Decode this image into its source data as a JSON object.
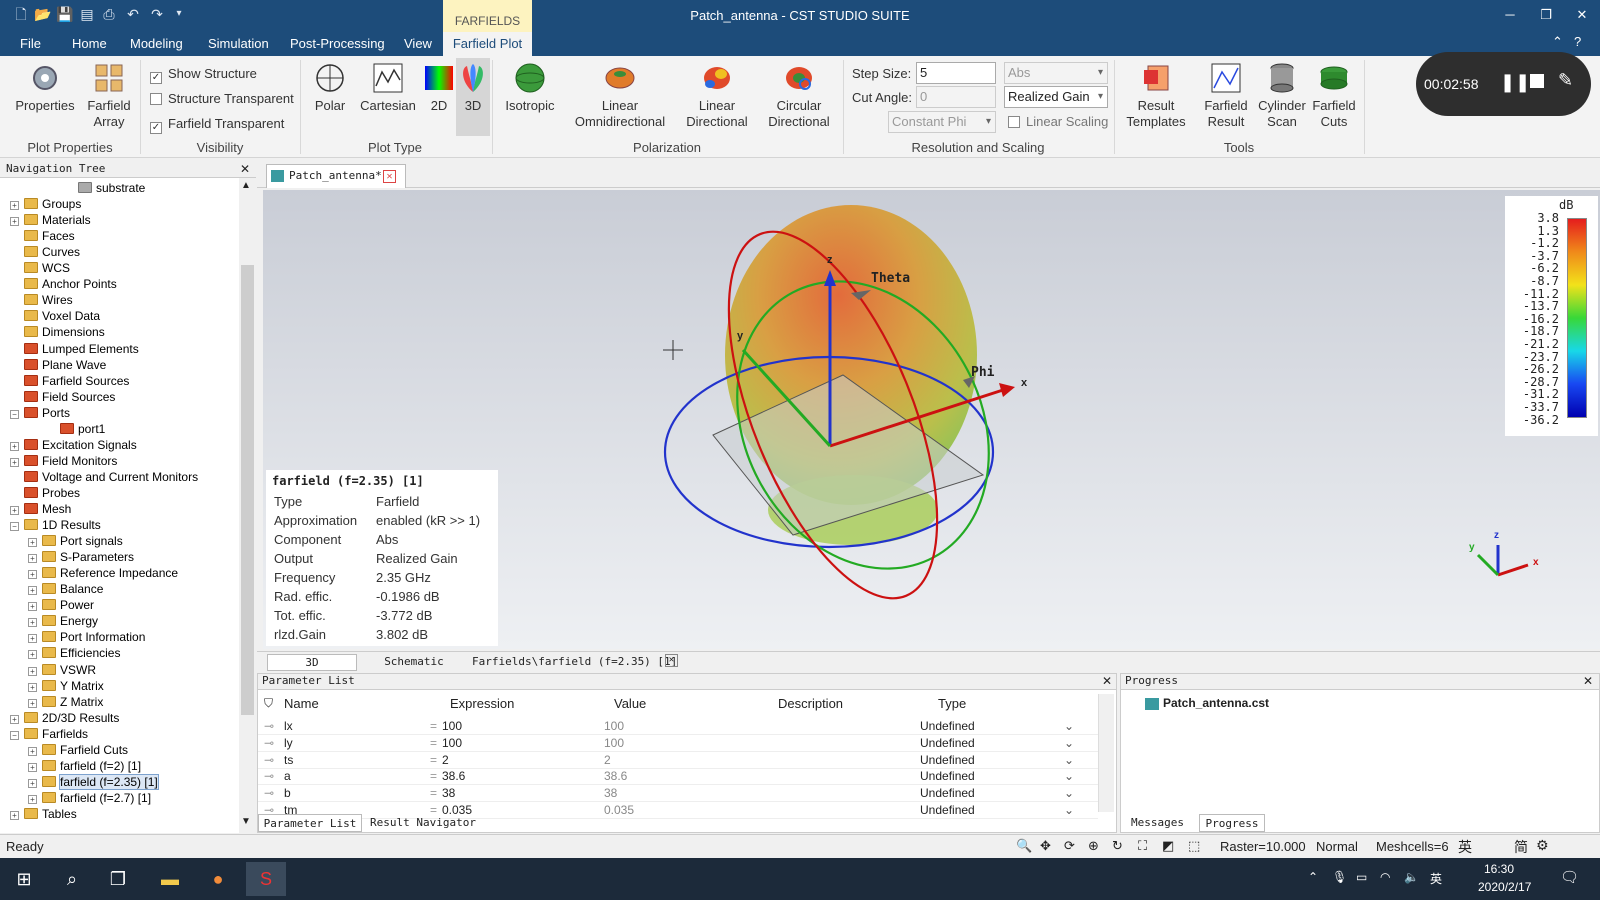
{
  "app": {
    "title": "Patch_antenna - CST STUDIO SUITE",
    "context_tab_group": "FARFIELDS"
  },
  "menu": [
    "File",
    "Home",
    "Modeling",
    "Simulation",
    "Post-Processing",
    "View",
    "Farfield Plot"
  ],
  "ribbon": {
    "plot_properties": {
      "properties": "Properties",
      "farfield_array_1": "Farfield",
      "farfield_array_2": "Array",
      "label": "Plot Properties"
    },
    "visibility": {
      "show_structure": "Show Structure",
      "structure_transparent": "Structure Transparent",
      "farfield_transparent": "Farfield Transparent",
      "label": "Visibility"
    },
    "plot_type": {
      "polar": "Polar",
      "cartesian": "Cartesian",
      "twod": "2D",
      "threed": "3D",
      "label": "Plot Type"
    },
    "polarization": {
      "isotropic": "Isotropic",
      "linear_omni_1": "Linear",
      "linear_omni_2": "Omnidirectional",
      "linear_dir_1": "Linear",
      "linear_dir_2": "Directional",
      "circular_dir_1": "Circular",
      "circular_dir_2": "Directional",
      "label": "Polarization"
    },
    "resolution": {
      "step_size_label": "Step Size:",
      "step_size_value": "5",
      "cut_angle_label": "Cut Angle:",
      "cut_angle_value": "0",
      "constant_phi": "Constant Phi",
      "abs": "Abs",
      "realized_gain": "Realized Gain",
      "linear_scaling": "Linear Scaling",
      "label": "Resolution and Scaling"
    },
    "tools": {
      "result_templates_1": "Result",
      "result_templates_2": "Templates",
      "farfield_result_1": "Farfield",
      "farfield_result_2": "Result",
      "cylinder_scan_1": "Cylinder",
      "cylinder_scan_2": "Scan",
      "farfield_cuts_1": "Farfield",
      "farfield_cuts_2": "Cuts",
      "label": "Tools"
    }
  },
  "recorder": {
    "time": "00:02:58"
  },
  "nav": {
    "title": "Navigation Tree",
    "items": [
      {
        "label": "substrate",
        "indent": 3,
        "icon": "gray",
        "exp": ""
      },
      {
        "label": "Groups",
        "indent": 0,
        "icon": "fold",
        "exp": "+"
      },
      {
        "label": "Materials",
        "indent": 0,
        "icon": "fold",
        "exp": "+"
      },
      {
        "label": "Faces",
        "indent": 0,
        "icon": "fold",
        "exp": ""
      },
      {
        "label": "Curves",
        "indent": 0,
        "icon": "fold",
        "exp": ""
      },
      {
        "label": "WCS",
        "indent": 0,
        "icon": "fold",
        "exp": ""
      },
      {
        "label": "Anchor Points",
        "indent": 0,
        "icon": "fold",
        "exp": ""
      },
      {
        "label": "Wires",
        "indent": 0,
        "icon": "fold",
        "exp": ""
      },
      {
        "label": "Voxel Data",
        "indent": 0,
        "icon": "fold",
        "exp": ""
      },
      {
        "label": "Dimensions",
        "indent": 0,
        "icon": "fold",
        "exp": ""
      },
      {
        "label": "Lumped Elements",
        "indent": 0,
        "icon": "red",
        "exp": ""
      },
      {
        "label": "Plane Wave",
        "indent": 0,
        "icon": "red",
        "exp": ""
      },
      {
        "label": "Farfield Sources",
        "indent": 0,
        "icon": "red",
        "exp": ""
      },
      {
        "label": "Field Sources",
        "indent": 0,
        "icon": "red",
        "exp": ""
      },
      {
        "label": "Ports",
        "indent": 0,
        "icon": "red",
        "exp": "−"
      },
      {
        "label": "port1",
        "indent": 2,
        "icon": "red",
        "exp": ""
      },
      {
        "label": "Excitation Signals",
        "indent": 0,
        "icon": "red",
        "exp": "+"
      },
      {
        "label": "Field Monitors",
        "indent": 0,
        "icon": "red",
        "exp": "+"
      },
      {
        "label": "Voltage and Current Monitors",
        "indent": 0,
        "icon": "red",
        "exp": ""
      },
      {
        "label": "Probes",
        "indent": 0,
        "icon": "red",
        "exp": ""
      },
      {
        "label": "Mesh",
        "indent": 0,
        "icon": "red",
        "exp": "+"
      },
      {
        "label": "1D Results",
        "indent": 0,
        "icon": "fold",
        "exp": "−"
      },
      {
        "label": "Port signals",
        "indent": 1,
        "icon": "fold",
        "exp": "+"
      },
      {
        "label": "S-Parameters",
        "indent": 1,
        "icon": "fold",
        "exp": "+"
      },
      {
        "label": "Reference Impedance",
        "indent": 1,
        "icon": "fold",
        "exp": "+"
      },
      {
        "label": "Balance",
        "indent": 1,
        "icon": "fold",
        "exp": "+"
      },
      {
        "label": "Power",
        "indent": 1,
        "icon": "fold",
        "exp": "+"
      },
      {
        "label": "Energy",
        "indent": 1,
        "icon": "fold",
        "exp": "+"
      },
      {
        "label": "Port Information",
        "indent": 1,
        "icon": "fold",
        "exp": "+"
      },
      {
        "label": "Efficiencies",
        "indent": 1,
        "icon": "fold",
        "exp": "+"
      },
      {
        "label": "VSWR",
        "indent": 1,
        "icon": "fold",
        "exp": "+"
      },
      {
        "label": "Y Matrix",
        "indent": 1,
        "icon": "fold",
        "exp": "+"
      },
      {
        "label": "Z Matrix",
        "indent": 1,
        "icon": "fold",
        "exp": "+"
      },
      {
        "label": "2D/3D Results",
        "indent": 0,
        "icon": "fold",
        "exp": "+"
      },
      {
        "label": "Farfields",
        "indent": 0,
        "icon": "fold",
        "exp": "−"
      },
      {
        "label": "Farfield Cuts",
        "indent": 1,
        "icon": "fold",
        "exp": "+"
      },
      {
        "label": "farfield (f=2) [1]",
        "indent": 1,
        "icon": "fold",
        "exp": "+"
      },
      {
        "label": "farfield (f=2.35) [1]",
        "indent": 1,
        "icon": "fold",
        "exp": "+",
        "selected": true
      },
      {
        "label": "farfield (f=2.7) [1]",
        "indent": 1,
        "icon": "fold",
        "exp": "+"
      },
      {
        "label": "Tables",
        "indent": 0,
        "icon": "fold",
        "exp": "+"
      }
    ]
  },
  "doc_tab": "Patch_antenna*",
  "viewport": {
    "axis_theta": "Theta",
    "axis_phi": "Phi",
    "axis_x": "x",
    "axis_y": "y",
    "axis_z": "z",
    "legend": {
      "unit": "dB",
      "values": [
        "3.8",
        "1.3",
        "-1.2",
        "-3.7",
        "-6.2",
        "-8.7",
        "-11.2",
        "-13.7",
        "-16.2",
        "-18.7",
        "-21.2",
        "-23.7",
        "-26.2",
        "-28.7",
        "-31.2",
        "-33.7",
        "-36.2"
      ]
    },
    "info": {
      "title": "farfield (f=2.35) [1]",
      "rows": [
        {
          "k": "Type",
          "v": "Farfield"
        },
        {
          "k": "Approximation",
          "v": "enabled (kR >> 1)"
        },
        {
          "k": "Component",
          "v": "Abs"
        },
        {
          "k": "Output",
          "v": "Realized Gain"
        },
        {
          "k": "Frequency",
          "v": "2.35 GHz"
        },
        {
          "k": "Rad. effic.",
          "v": "-0.1986 dB"
        },
        {
          "k": "Tot. effic.",
          "v": "-3.772 dB"
        },
        {
          "k": "rlzd.Gain",
          "v": "3.802 dB"
        }
      ]
    },
    "mini_axes": {
      "x": "x",
      "y": "y",
      "z": "z"
    }
  },
  "view_tabs": [
    "3D",
    "Schematic",
    "Farfields\\farfield (f=2.35) [1]"
  ],
  "params": {
    "title": "Parameter List",
    "columns": [
      "Name",
      "Expression",
      "Value",
      "Description",
      "Type"
    ],
    "rows": [
      {
        "name": "lx",
        "expr": "100",
        "value": "100",
        "type": "Undefined"
      },
      {
        "name": "ly",
        "expr": "100",
        "value": "100",
        "type": "Undefined"
      },
      {
        "name": "ts",
        "expr": "2",
        "value": "2",
        "type": "Undefined"
      },
      {
        "name": "a",
        "expr": "38.6",
        "value": "38.6",
        "type": "Undefined"
      },
      {
        "name": "b",
        "expr": "38",
        "value": "38",
        "type": "Undefined"
      },
      {
        "name": "tm",
        "expr": "0.035",
        "value": "0.035",
        "type": "Undefined"
      }
    ],
    "tabs": [
      "Parameter List",
      "Result Navigator"
    ]
  },
  "progress": {
    "title": "Progress",
    "file": "Patch_antenna.cst",
    "tabs": [
      "Messages",
      "Progress"
    ]
  },
  "status": {
    "ready": "Ready",
    "raster": "Raster=10.000",
    "mode": "Normal",
    "meshcells": "Meshcells=6",
    "ime1": "英",
    "ime2": "简"
  },
  "taskbar": {
    "time": "16:30",
    "date": "2020/2/17",
    "lang": "英"
  },
  "colors": {
    "title_bar": "#1d4c7a",
    "context_tab": "#fdf3c0",
    "taskbar": "#1c2a3a"
  }
}
